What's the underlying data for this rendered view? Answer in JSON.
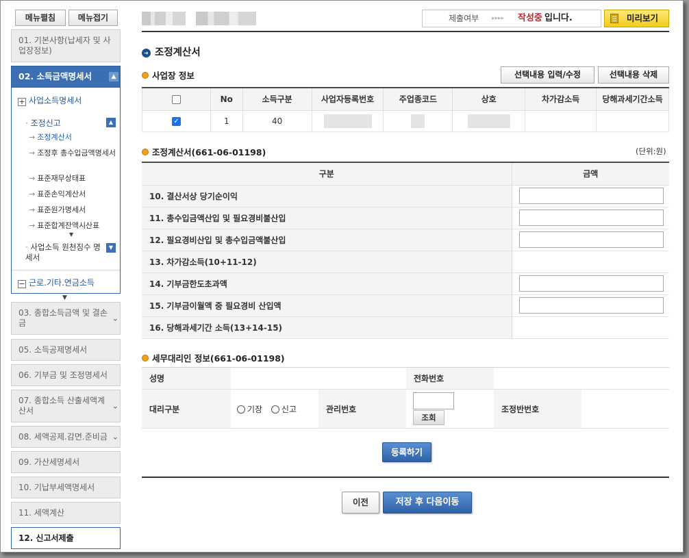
{
  "sidebar": {
    "expand_all": "메뉴펼침",
    "collapse_all": "메뉴접기",
    "item01": "01. 기본사항(납세자 및 사업장정보)",
    "item02": "02. 소득금액명세서",
    "group_business_income": "사업소득명세서",
    "sub_adjustment_filing": "조정신고",
    "links": [
      "조정계산서",
      "조정후 총수입금액명세서",
      "표준재무상태표",
      "표준손익계산서",
      "표준원가명세서",
      "표준합계잔액시산표"
    ],
    "sub_withholding": "사업소득 원천징수 명세서",
    "group_labor": "근로.기타.연금소득",
    "item03": "03. 종합소득금액 및 결손금",
    "item05": "05. 소득공제명세서",
    "item06": "06. 기부금 및 조정명세서",
    "item07": "07. 종합소득 산출세액계산서",
    "item08": "08. 세액공제.감면.준비금",
    "item09": "09. 가산세명세서",
    "item10": "10. 기납부세액명세서",
    "item11": "11. 세액계산",
    "item12": "12. 신고서제출"
  },
  "header": {
    "status_label": "제출여부",
    "status_arrows": "▸▸▸▸",
    "status_value": "작성중",
    "status_suffix": "입니다.",
    "preview_button": "미리보기"
  },
  "page_title": "조정계산서",
  "business_info": {
    "heading": "사업장 정보",
    "edit_button": "선택내용 입력/수정",
    "delete_button": "선택내용 삭제",
    "columns": [
      "No",
      "소득구분",
      "사업자등록번호",
      "주업종코드",
      "상호",
      "차가감소득",
      "당해과세기간소득"
    ],
    "row": {
      "no": "1",
      "income_type": "40"
    }
  },
  "adjustment": {
    "heading": "조정계산서(661-06-01198)",
    "unit": "(단위:원)",
    "col_category": "구분",
    "col_amount": "금액",
    "rows": [
      "10. 결산서상 당기순이익",
      "11. 총수입금액산입 및 필요경비불산입",
      "12. 필요경비산입 및 총수입금액불산입",
      "13. 차가감소득(10+11-12)",
      "14. 기부금한도초과액",
      "15. 기부금이월액 중 필요경비 산입액",
      "16. 당해과세기간 소득(13+14-15)"
    ]
  },
  "agent": {
    "heading": "세무대리인 정보(661-06-01198)",
    "name_label": "성명",
    "phone_label": "전화번호",
    "type_label": "대리구분",
    "radio_bookkeeping": "기장",
    "radio_filing": "신고",
    "mgmt_label": "관리번호",
    "lookup_button": "조회",
    "team_label": "조정반번호"
  },
  "register_button": "등록하기",
  "prev_button": "이전",
  "save_next_button": "저장 후 다음이동"
}
